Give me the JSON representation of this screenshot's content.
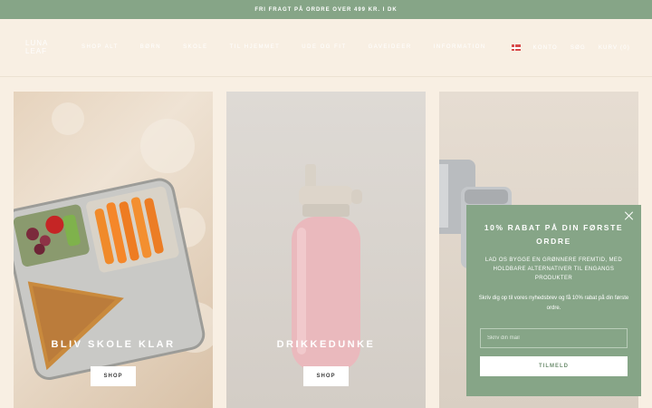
{
  "announcement": "FRI FRAGT PÅ ORDRE OVER 499 KR. I DK",
  "header": {
    "logo": "LUNA LEAF",
    "nav": [
      "SHOP ALT",
      "BØRN",
      "SKOLE",
      "TIL HJEMMET",
      "UDE OG FIT",
      "GAVEIDEER",
      "INFORMATION"
    ],
    "utils": {
      "account": "KONTO",
      "search": "SØG",
      "cart": "KURV (0)"
    }
  },
  "cards": [
    {
      "title": "BLIV SKOLE KLAR",
      "button": "SHOP"
    },
    {
      "title": "DRIKKEDUNKE",
      "button": "SHOP"
    }
  ],
  "popup": {
    "title": "10% RABAT PÅ DIN FØRSTE ORDRE",
    "subtitle": "LAD OS BYGGE EN GRØNNERE FREMTID, MED HOLDBARE ALTERNATIVER TIL ENGANGS PRODUKTER",
    "text": "Skriv dig op til vores nyhedsbrev og få 10% rabat på din første ordre.",
    "email_placeholder": "Skriv din mail",
    "button": "TILMELD"
  }
}
